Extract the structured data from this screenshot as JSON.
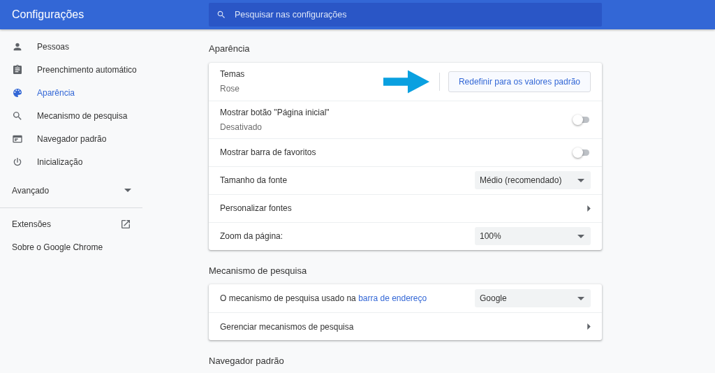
{
  "header": {
    "title": "Configurações",
    "search": {
      "placeholder": "Pesquisar nas configurações"
    }
  },
  "sidebar": {
    "items": [
      {
        "label": "Pessoas",
        "selected": false
      },
      {
        "label": "Preenchimento automático",
        "selected": false
      },
      {
        "label": "Aparência",
        "selected": true
      },
      {
        "label": "Mecanismo de pesquisa",
        "selected": false
      },
      {
        "label": "Navegador padrão",
        "selected": false
      },
      {
        "label": "Inicialização",
        "selected": false
      }
    ],
    "advanced": {
      "label": "Avançado",
      "expanded": false
    },
    "links": [
      {
        "label": "Extensões",
        "external": true
      },
      {
        "label": "Sobre o Google Chrome",
        "external": false
      }
    ]
  },
  "sections": [
    {
      "title": "Aparência",
      "rows": [
        {
          "kind": "button",
          "label": "Temas",
          "sublabel": "Rose",
          "button": "Redefinir para os valores padrão"
        },
        {
          "kind": "toggle",
          "label": "Mostrar botão \"Página inicial\"",
          "sublabel": "Desativado",
          "on": false
        },
        {
          "kind": "toggle",
          "label": "Mostrar barra de favoritos",
          "on": false
        },
        {
          "kind": "select",
          "label": "Tamanho da fonte",
          "value": "Médio (recomendado)"
        },
        {
          "kind": "link",
          "label": "Personalizar fontes"
        },
        {
          "kind": "select",
          "label": "Zoom da página:",
          "value": "100%"
        }
      ]
    },
    {
      "title": "Mecanismo de pesquisa",
      "rows": [
        {
          "kind": "select",
          "label": "O mecanismo de pesquisa usado na",
          "link": "barra de endereço",
          "value": "Google"
        },
        {
          "kind": "link",
          "label": "Gerenciar mecanismos de pesquisa"
        }
      ]
    },
    {
      "title": "Navegador padrão"
    }
  ]
}
